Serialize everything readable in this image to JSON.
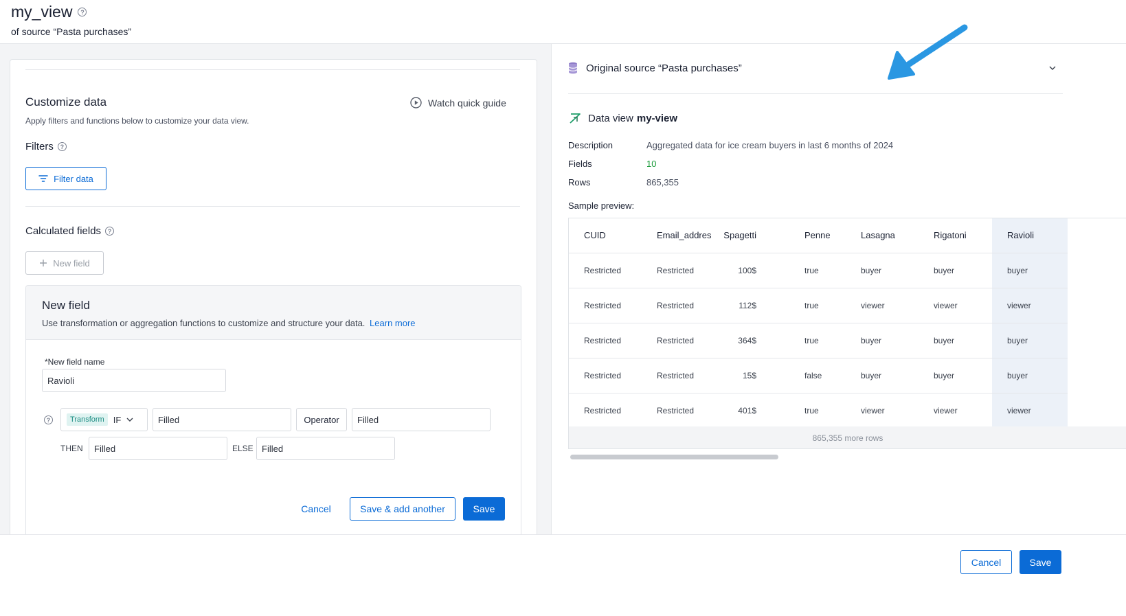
{
  "header": {
    "title": "my_view",
    "subtitle": "of source “Pasta purchases”"
  },
  "customize": {
    "title": "Customize data",
    "description": "Apply filters and functions below to customize your data view.",
    "watch_guide": "Watch quick guide",
    "filters_label": "Filters",
    "filter_button": "Filter data",
    "calculated_label": "Calculated fields",
    "new_field_button": "New field"
  },
  "new_field": {
    "title": "New field",
    "description": "Use transformation or aggregation functions to customize and structure your data.",
    "learn_more": "Learn more",
    "name_label": "*New field name",
    "name_value": "Ravioli",
    "transform_tag": "Transform",
    "if_label": "IF",
    "condition_value": "Filled",
    "operator_label": "Operator",
    "operator_value": "Filled",
    "then_label": "THEN",
    "then_value": "Filled",
    "else_label": "ELSE",
    "else_value": "Filled",
    "cancel": "Cancel",
    "save_add": "Save & add another",
    "save": "Save"
  },
  "right": {
    "source_title": "Original source “Pasta purchases”",
    "data_view_prefix": "Data view",
    "data_view_name": "my-view",
    "description_label": "Description",
    "description_value": "Aggregated data for ice cream buyers in last 6 months of 2024",
    "fields_label": "Fields",
    "fields_value": "10",
    "rows_label": "Rows",
    "rows_value": "865,355",
    "sample_label": "Sample preview:",
    "more_rows": "865,355 more rows"
  },
  "table": {
    "headers": [
      "CUID",
      "Email_addres",
      "Spagetti",
      "Penne",
      "Lasagna",
      "Rigatoni",
      "Ravioli"
    ],
    "rows": [
      [
        "Restricted",
        "Restricted",
        "100$",
        "true",
        "buyer",
        "buyer",
        "buyer"
      ],
      [
        "Restricted",
        "Restricted",
        "112$",
        "true",
        "viewer",
        "viewer",
        "viewer"
      ],
      [
        "Restricted",
        "Restricted",
        "364$",
        "true",
        "buyer",
        "buyer",
        "buyer"
      ],
      [
        "Restricted",
        "Restricted",
        "15$",
        "false",
        "buyer",
        "buyer",
        "buyer"
      ],
      [
        "Restricted",
        "Restricted",
        "401$",
        "true",
        "viewer",
        "viewer",
        "viewer"
      ]
    ]
  },
  "footer": {
    "cancel": "Cancel",
    "save": "Save"
  },
  "colors": {
    "primary": "#0b6bd6",
    "fields_green": "#1a9a3a",
    "arrow": "#2a97e2",
    "transform_tag_bg": "#dff3f1",
    "transform_tag_text": "#1a8c82"
  },
  "icons": {
    "help": "question-circle-icon",
    "play": "play-circle-icon",
    "filter": "filter-lines-icon",
    "plus": "plus-icon",
    "chevron": "chevron-down-icon",
    "database": "database-icon",
    "data_view": "data-view-icon",
    "arrow": "annotation-arrow-icon"
  }
}
